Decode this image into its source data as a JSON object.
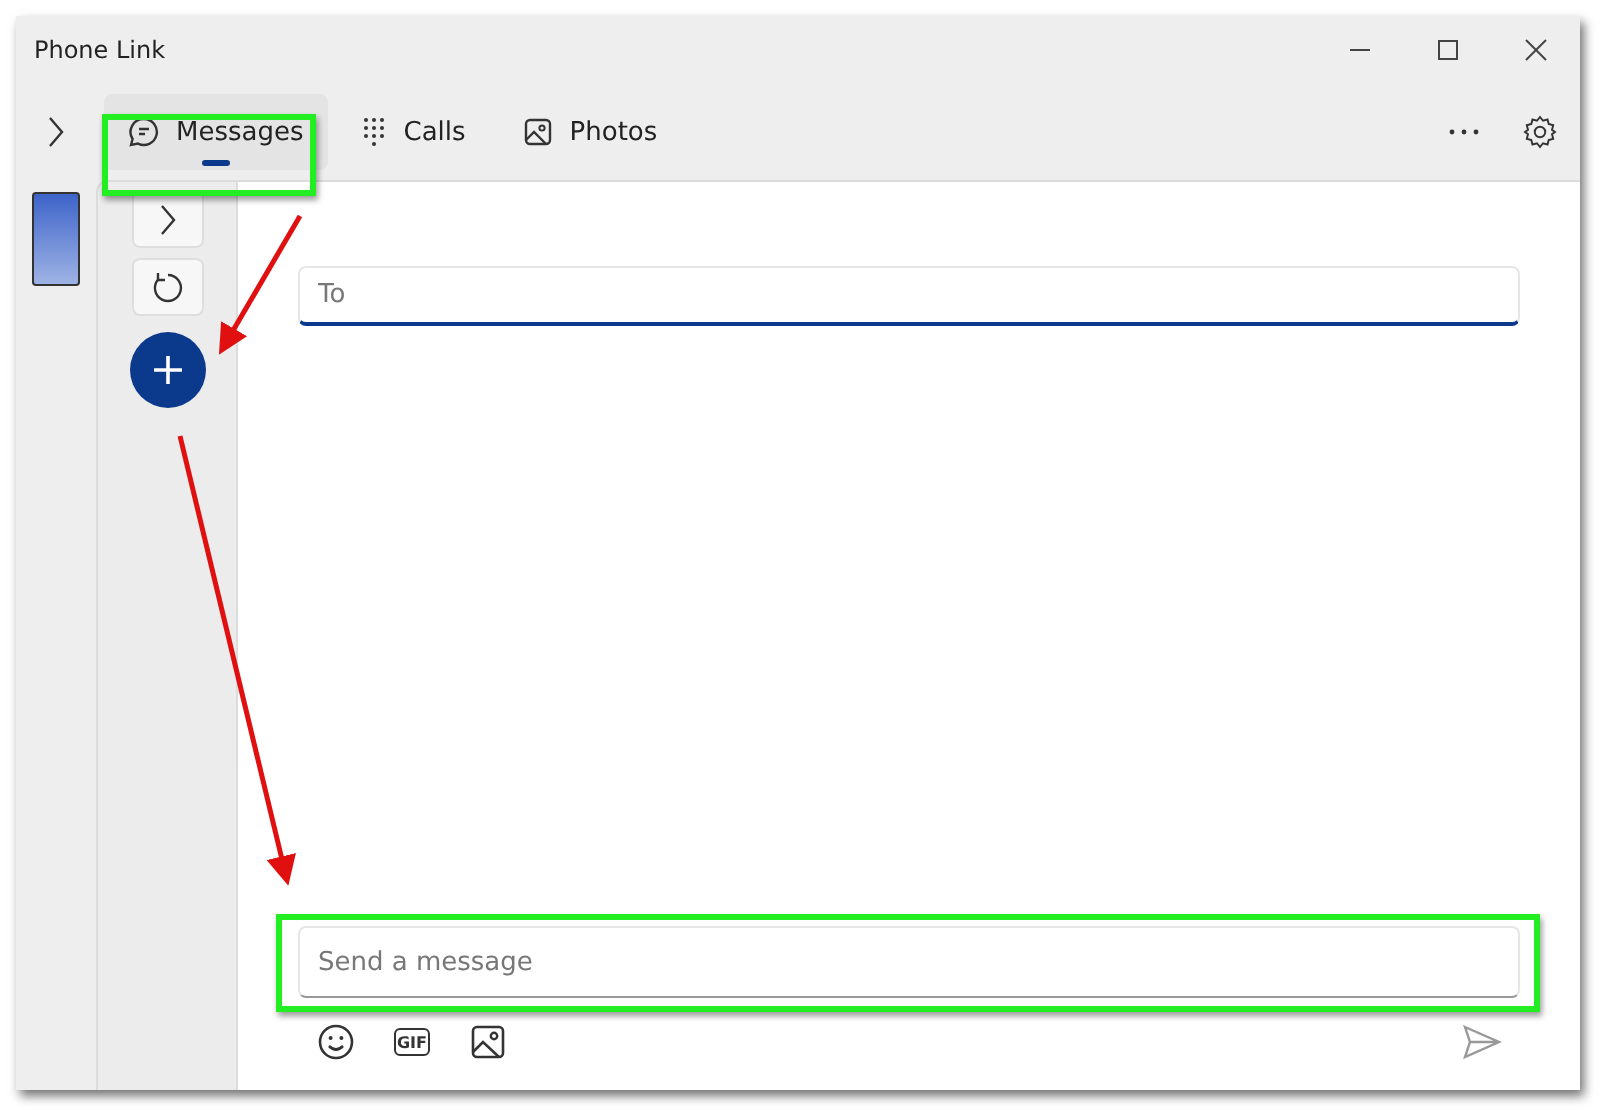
{
  "window": {
    "title": "Phone Link"
  },
  "tabs": [
    {
      "label": "Messages",
      "selected": true
    },
    {
      "label": "Calls",
      "selected": false
    },
    {
      "label": "Photos",
      "selected": false
    }
  ],
  "compose": {
    "to_placeholder": "To",
    "message_placeholder": "Send a message",
    "gif_label": "GIF"
  }
}
